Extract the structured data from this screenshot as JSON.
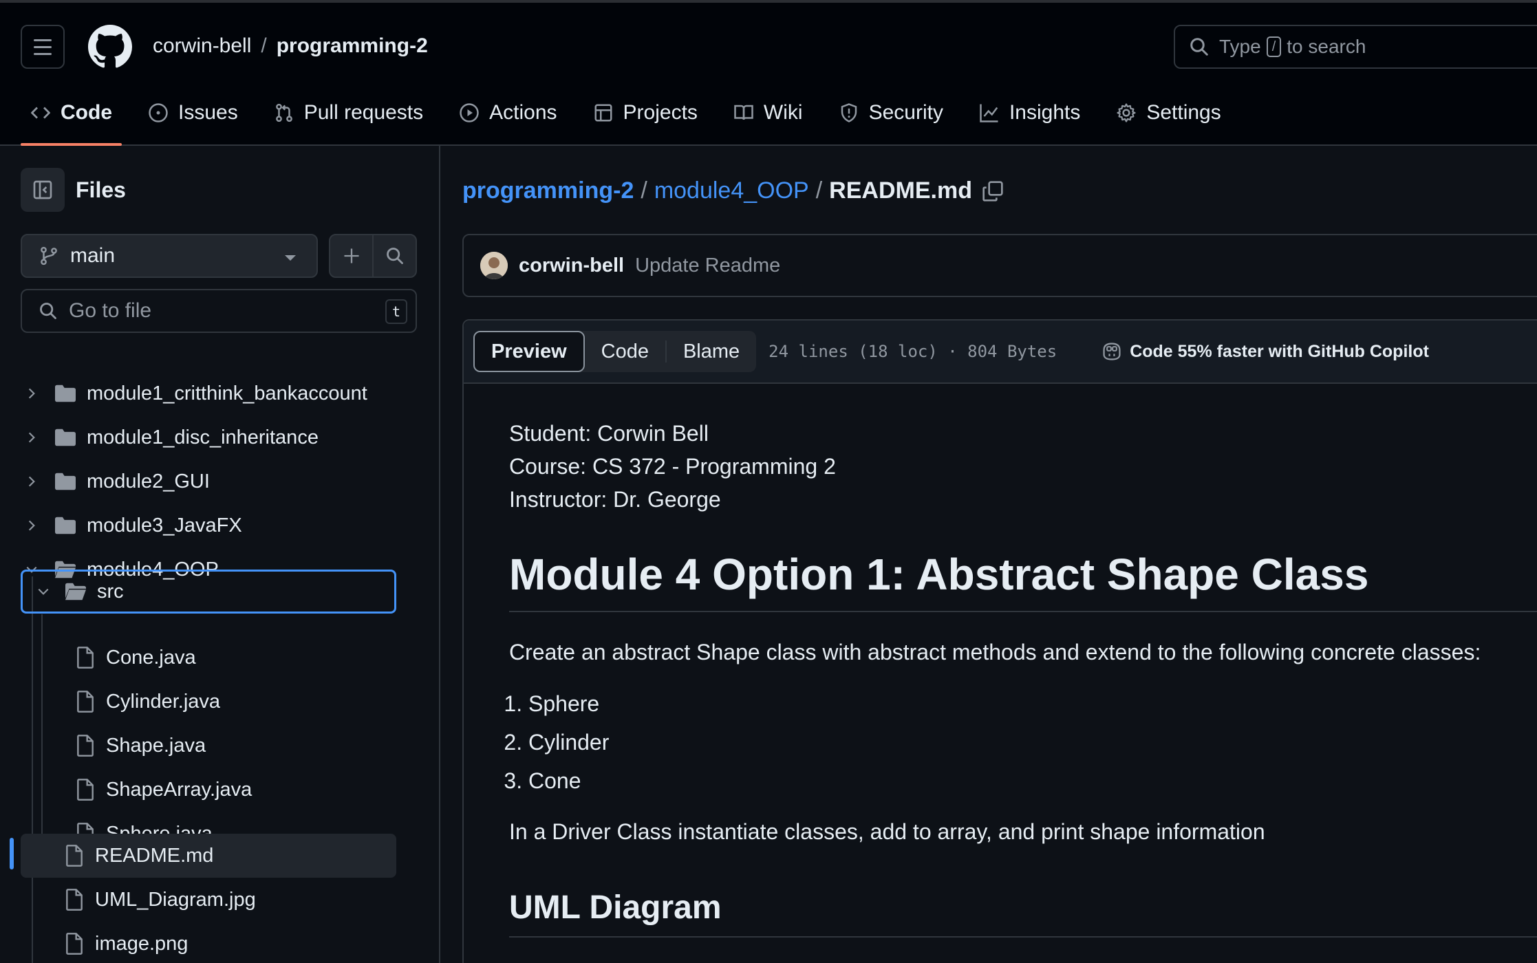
{
  "header": {
    "owner": "corwin-bell",
    "separator": "/",
    "repo": "programming-2",
    "search": {
      "prefix": "Type",
      "key": "/",
      "suffix": "to search"
    }
  },
  "nav": [
    {
      "label": "Code",
      "icon": "code-icon",
      "active": true
    },
    {
      "label": "Issues",
      "icon": "issue-icon"
    },
    {
      "label": "Pull requests",
      "icon": "pull-request-icon"
    },
    {
      "label": "Actions",
      "icon": "play-icon"
    },
    {
      "label": "Projects",
      "icon": "table-icon"
    },
    {
      "label": "Wiki",
      "icon": "book-icon"
    },
    {
      "label": "Security",
      "icon": "shield-icon"
    },
    {
      "label": "Insights",
      "icon": "graph-icon"
    },
    {
      "label": "Settings",
      "icon": "gear-icon"
    }
  ],
  "sidebar": {
    "title": "Files",
    "branch": "main",
    "goto_placeholder": "Go to file",
    "goto_shortcut": "t",
    "tree": [
      {
        "name": "module1_critthink_bankaccount",
        "type": "folder",
        "expanded": false
      },
      {
        "name": "module1_disc_inheritance",
        "type": "folder",
        "expanded": false
      },
      {
        "name": "module2_GUI",
        "type": "folder",
        "expanded": false
      },
      {
        "name": "module3_JavaFX",
        "type": "folder",
        "expanded": false
      },
      {
        "name": "module4_OOP",
        "type": "folder",
        "expanded": true
      },
      {
        "name": "src",
        "type": "folder",
        "expanded": true,
        "focused": true
      },
      {
        "name": "Cone.java",
        "type": "file"
      },
      {
        "name": "Cylinder.java",
        "type": "file"
      },
      {
        "name": "Shape.java",
        "type": "file"
      },
      {
        "name": "ShapeArray.java",
        "type": "file"
      },
      {
        "name": "Sphere.java",
        "type": "file"
      },
      {
        "name": "README.md",
        "type": "file",
        "current": true
      },
      {
        "name": "UML_Diagram.jpg",
        "type": "file"
      },
      {
        "name": "image.png",
        "type": "file"
      }
    ]
  },
  "breadcrumb": {
    "repo": "programming-2",
    "folder": "module4_OOP",
    "file": "README.md",
    "sep": "/"
  },
  "commit": {
    "author": "corwin-bell",
    "message": "Update Readme"
  },
  "file_view": {
    "tabs": [
      "Preview",
      "Code",
      "Blame"
    ],
    "active_tab": "Preview",
    "meta": "24 lines (18 loc) · 804 Bytes",
    "copilot": "Code 55% faster with GitHub Copilot"
  },
  "readme": {
    "student": "Student: Corwin Bell",
    "course": "Course: CS 372 - Programming 2",
    "instructor": "Instructor: Dr. George",
    "heading": "Module 4 Option 1: Abstract Shape Class",
    "description": "Create an abstract Shape class with abstract methods and extend to the following concrete classes:",
    "items": [
      "Sphere",
      "Cylinder",
      "Cone"
    ],
    "driver": "In a Driver Class instantiate classes, add to array, and print shape information",
    "subheading": "UML Diagram"
  },
  "colors": {
    "bg": "#0d1117",
    "header_bg": "#010409",
    "border": "#30363d",
    "link": "#4493f8",
    "active_tab_underline": "#f78166",
    "muted": "#9198a1"
  }
}
